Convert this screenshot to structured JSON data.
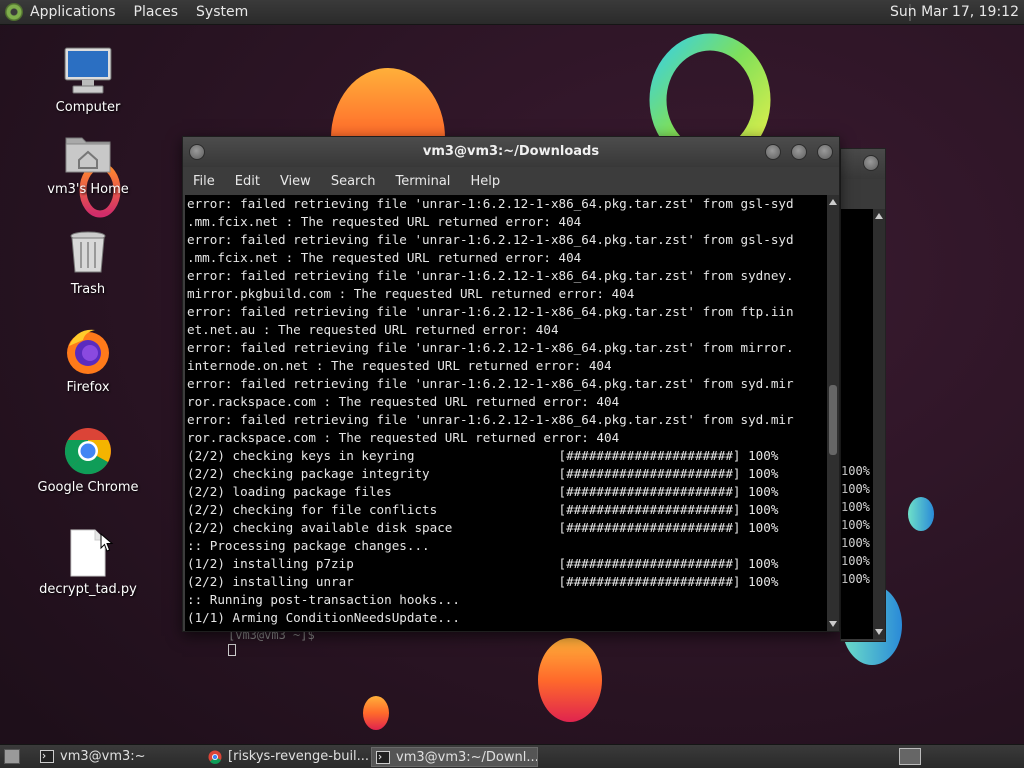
{
  "top_panel": {
    "menus": [
      "Applications",
      "Places",
      "System"
    ],
    "clock": "Sun Mar 17, 19:12"
  },
  "desktop_icons": [
    {
      "label": "Computer",
      "icon": "computer-icon"
    },
    {
      "label": "vm3's Home",
      "icon": "home-folder-icon"
    },
    {
      "label": "Trash",
      "icon": "trash-icon"
    },
    {
      "label": "Firefox",
      "icon": "firefox-icon"
    },
    {
      "label": "Google Chrome",
      "icon": "chrome-icon"
    },
    {
      "label": "decrypt_tad.py",
      "icon": "file-icon"
    }
  ],
  "terminal": {
    "title": "vm3@vm3:~/Downloads",
    "menu": [
      "File",
      "Edit",
      "View",
      "Search",
      "Terminal",
      "Help"
    ],
    "lines": [
      "error: failed retrieving file 'unrar-1:6.2.12-1-x86_64.pkg.tar.zst' from gsl-syd",
      ".mm.fcix.net : The requested URL returned error: 404",
      "error: failed retrieving file 'unrar-1:6.2.12-1-x86_64.pkg.tar.zst' from gsl-syd",
      ".mm.fcix.net : The requested URL returned error: 404",
      "error: failed retrieving file 'unrar-1:6.2.12-1-x86_64.pkg.tar.zst' from sydney.",
      "mirror.pkgbuild.com : The requested URL returned error: 404",
      "error: failed retrieving file 'unrar-1:6.2.12-1-x86_64.pkg.tar.zst' from ftp.iin",
      "et.net.au : The requested URL returned error: 404",
      "error: failed retrieving file 'unrar-1:6.2.12-1-x86_64.pkg.tar.zst' from mirror.",
      "internode.on.net : The requested URL returned error: 404",
      "error: failed retrieving file 'unrar-1:6.2.12-1-x86_64.pkg.tar.zst' from syd.mir",
      "ror.rackspace.com : The requested URL returned error: 404",
      "error: failed retrieving file 'unrar-1:6.2.12-1-x86_64.pkg.tar.zst' from syd.mir",
      "ror.rackspace.com : The requested URL returned error: 404",
      "(2/2) checking keys in keyring                   [######################] 100%",
      "(2/2) checking package integrity                 [######################] 100%",
      "(2/2) loading package files                      [######################] 100%",
      "(2/2) checking for file conflicts                [######################] 100%",
      "(2/2) checking available disk space              [######################] 100%",
      ":: Processing package changes...",
      "(1/2) installing p7zip                           [######################] 100%",
      "(2/2) installing unrar                           [######################] 100%",
      ":: Running post-transaction hooks...",
      "(1/1) Arming ConditionNeedsUpdate..."
    ]
  },
  "background_terminal": {
    "prompt": "[vm3@vm3 ~]$",
    "percent_labels": [
      "100%",
      "100%",
      "100%",
      "100%",
      "100%",
      "100%",
      "100%"
    ]
  },
  "taskbar": {
    "tasks": [
      {
        "label": "vm3@vm3:~",
        "icon": "terminal-icon",
        "active": false
      },
      {
        "label": "[riskys-revenge-buil...",
        "icon": "chrome-icon",
        "active": false
      },
      {
        "label": "vm3@vm3:~/Downl...",
        "icon": "terminal-icon",
        "active": true
      }
    ]
  },
  "colors": {
    "desktop_bg": "#25121f",
    "panel_bg": "#2f2f2f",
    "terminal_bg": "#000000",
    "terminal_fg": "#e6e6e6"
  }
}
